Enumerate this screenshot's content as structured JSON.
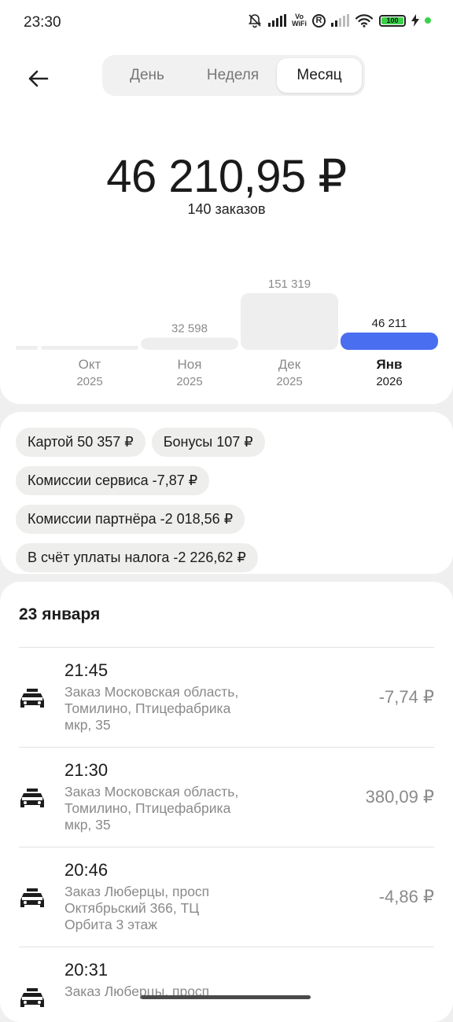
{
  "status_bar": {
    "time": "23:30",
    "wifi_label": "Vo\nWiFi",
    "r_label": "R",
    "battery": "100"
  },
  "header": {
    "tabs": [
      "День",
      "Неделя",
      "Месяц"
    ],
    "active_tab": "Месяц"
  },
  "summary": {
    "amount": "46 210,95 ₽",
    "orders": "140 заказов"
  },
  "chart_data": {
    "type": "bar",
    "categories": [
      "Окт 2025",
      "Ноя 2025",
      "Дек 2025",
      "Янв 2026"
    ],
    "months": [
      "Окт",
      "Ноя",
      "Дек",
      "Янв"
    ],
    "years": [
      "2025",
      "2025",
      "2025",
      "2026"
    ],
    "values": [
      0,
      32598,
      151319,
      46211
    ],
    "value_labels": [
      "",
      "32 598",
      "151 319",
      "46 211"
    ],
    "highlighted": "Янв 2026",
    "colors": {
      "bar": "#eeeeee",
      "highlight": "#4a6ef0"
    }
  },
  "breakdown": {
    "chips": [
      "Картой 50 357 ₽",
      "Бонусы 107 ₽",
      "Комиссии сервиса -7,87 ₽",
      "Комиссии партнёра -2 018,56 ₽",
      "В счёт уплаты налога -2 226,62 ₽"
    ]
  },
  "orders_list": {
    "date": "23 января",
    "items": [
      {
        "time": "21:45",
        "address": "Заказ Московская область, Томилино, Птицефабрика мкр, 35",
        "amount": "-7,74 ₽"
      },
      {
        "time": "21:30",
        "address": "Заказ Московская область, Томилино, Птицефабрика мкр, 35",
        "amount": "380,09 ₽"
      },
      {
        "time": "20:46",
        "address": "Заказ Люберцы, просп Октябрьский 366, ТЦ Орбита 3 этаж",
        "amount": "-4,86 ₽"
      },
      {
        "time": "20:31",
        "address": "Заказ Люберцы, просп",
        "amount": ""
      }
    ]
  },
  "icons": {
    "back": "arrow-left-icon",
    "car": "taxi-car-icon",
    "mute": "bell-off-icon"
  },
  "colors": {
    "accent": "#4a6ef0",
    "muted_text": "#8a8a8a",
    "chip_bg": "#eeeeec"
  }
}
